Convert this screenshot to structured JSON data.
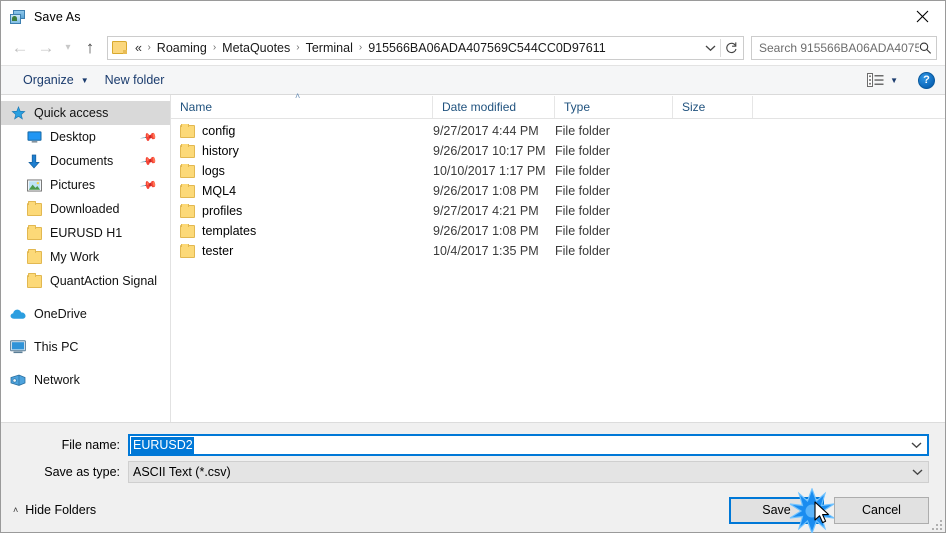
{
  "window": {
    "title": "Save As",
    "title_icon": "save-as-app-icon",
    "close_icon": "close-icon"
  },
  "nav": {
    "back_icon": "back-arrow-icon",
    "forward_icon": "forward-arrow-icon",
    "recent_icon": "chevron-down-icon",
    "up_icon": "up-arrow-icon",
    "breadcrumb": {
      "folder_icon": "folder-icon",
      "lead": "«",
      "items": [
        "Roaming",
        "MetaQuotes",
        "Terminal",
        "915566BA06ADA407569C544CC0D97611"
      ],
      "separator": "›",
      "dropdown_icon": "chevron-down-icon",
      "refresh_icon": "refresh-icon"
    },
    "search": {
      "placeholder": "Search 915566BA06ADA40756...",
      "icon": "search-icon"
    }
  },
  "toolbar": {
    "organize": "Organize",
    "organize_caret": "▼",
    "new_folder": "New folder",
    "view_icon": "change-view-icon",
    "view_caret": "▼",
    "help": "?",
    "help_icon": "help-icon"
  },
  "sidebar": {
    "items": [
      {
        "label": "Quick access",
        "icon": "star-icon",
        "level": 0,
        "selected": true,
        "pinned": false,
        "group": false
      },
      {
        "label": "Desktop",
        "icon": "desktop-icon",
        "level": 1,
        "selected": false,
        "pinned": true,
        "group": false
      },
      {
        "label": "Documents",
        "icon": "documents-icon",
        "level": 1,
        "selected": false,
        "pinned": true,
        "group": false
      },
      {
        "label": "Pictures",
        "icon": "pictures-icon",
        "level": 1,
        "selected": false,
        "pinned": true,
        "group": false
      },
      {
        "label": "Downloaded",
        "icon": "folder-icon",
        "level": 1,
        "selected": false,
        "pinned": false,
        "group": false
      },
      {
        "label": "EURUSD H1",
        "icon": "folder-icon",
        "level": 1,
        "selected": false,
        "pinned": false,
        "group": false
      },
      {
        "label": "My Work",
        "icon": "folder-icon",
        "level": 1,
        "selected": false,
        "pinned": false,
        "group": false
      },
      {
        "label": "QuantAction Signal",
        "icon": "folder-icon",
        "level": 1,
        "selected": false,
        "pinned": false,
        "group": false
      },
      {
        "label": "OneDrive",
        "icon": "onedrive-icon",
        "level": 0,
        "selected": false,
        "pinned": false,
        "group": true
      },
      {
        "label": "This PC",
        "icon": "this-pc-icon",
        "level": 0,
        "selected": false,
        "pinned": false,
        "group": true
      },
      {
        "label": "Network",
        "icon": "network-icon",
        "level": 0,
        "selected": false,
        "pinned": false,
        "group": true
      }
    ],
    "pin_icon": "pin-icon"
  },
  "filelist": {
    "columns": [
      "Name",
      "Date modified",
      "Type",
      "Size"
    ],
    "sort_caret": "˄",
    "rows": [
      {
        "name": "config",
        "date": "9/27/2017 4:44 PM",
        "type": "File folder",
        "size": "",
        "icon": "folder-icon"
      },
      {
        "name": "history",
        "date": "9/26/2017 10:17 PM",
        "type": "File folder",
        "size": "",
        "icon": "folder-icon"
      },
      {
        "name": "logs",
        "date": "10/10/2017 1:17 PM",
        "type": "File folder",
        "size": "",
        "icon": "folder-icon"
      },
      {
        "name": "MQL4",
        "date": "9/26/2017 1:08 PM",
        "type": "File folder",
        "size": "",
        "icon": "folder-icon"
      },
      {
        "name": "profiles",
        "date": "9/27/2017 4:21 PM",
        "type": "File folder",
        "size": "",
        "icon": "folder-icon"
      },
      {
        "name": "templates",
        "date": "9/26/2017 1:08 PM",
        "type": "File folder",
        "size": "",
        "icon": "folder-icon"
      },
      {
        "name": "tester",
        "date": "10/4/2017 1:35 PM",
        "type": "File folder",
        "size": "",
        "icon": "folder-icon"
      }
    ]
  },
  "form": {
    "file_name_label": "File name:",
    "file_name_value": "EURUSD2",
    "file_name_dropdown_icon": "chevron-down-icon",
    "save_type_label": "Save as type:",
    "save_type_value": "ASCII Text (*.csv)",
    "save_type_dropdown_icon": "chevron-down-icon"
  },
  "footer": {
    "hide_folders": "Hide Folders",
    "hide_folders_caret": "˄",
    "save": "Save",
    "cancel": "Cancel",
    "resize_grip_icon": "resize-grip-icon",
    "cursor_icon": "mouse-pointer-icon",
    "click_effect_icon": "click-burst-icon"
  },
  "colors": {
    "accent": "#0078d7",
    "folder": "#fcd978",
    "header_text": "#21537f",
    "toolbar_text": "#1b3c6e",
    "selection": "#d9d9d9"
  }
}
